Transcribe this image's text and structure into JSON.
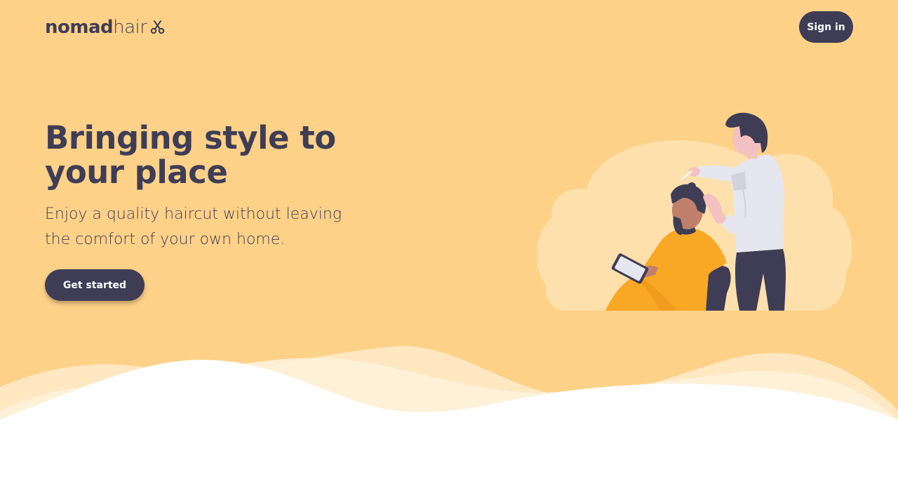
{
  "colors": {
    "background": "#fed188",
    "cloud": "#fde0ab",
    "dark": "#3f3d56",
    "accent": "#f9a826",
    "white": "#ffffff"
  },
  "header": {
    "logo_bold": "nomad",
    "logo_light": "hair",
    "logo_icon": "scissors-icon",
    "signin_label": "Sign in"
  },
  "hero": {
    "headline": "Bringing style to your place",
    "subtitle": "Enjoy a quality haircut without leaving the comfort of your own home.",
    "cta_label": "Get started"
  },
  "illustration": {
    "name": "barber-cutting-hair-illustration"
  }
}
